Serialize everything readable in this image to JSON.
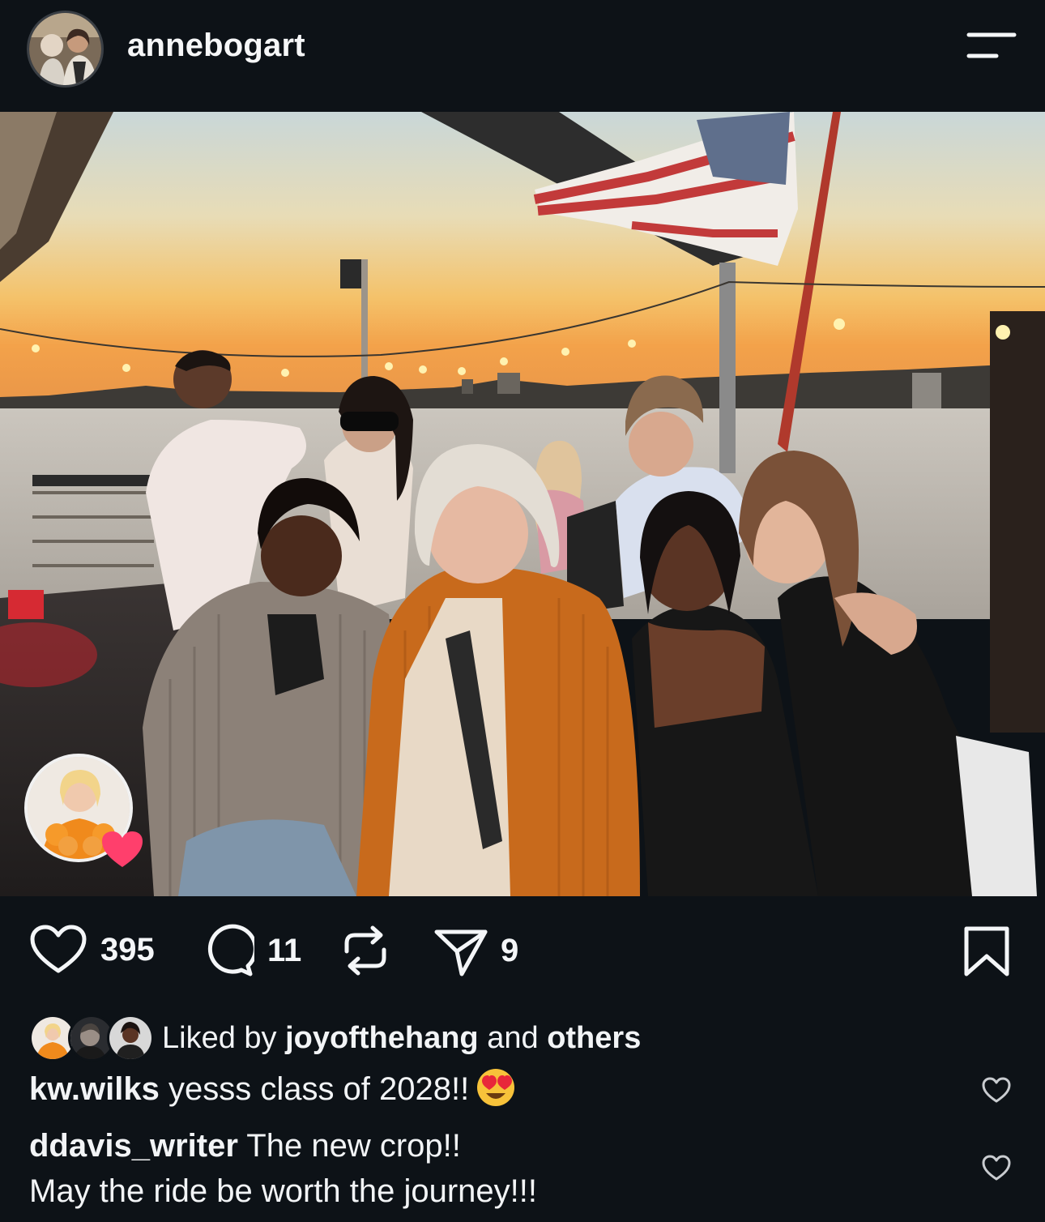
{
  "post": {
    "username": "annebogart"
  },
  "actions": {
    "likes": "395",
    "comments": "11",
    "shares": "9"
  },
  "liked_by": {
    "prefix": "Liked by",
    "user": "joyofthehang",
    "middle": "and",
    "suffix": "others"
  },
  "comments": [
    {
      "user": "kw.wilks",
      "text": "yesss class of 2028!!",
      "emoji": "heart-eyes-emoji"
    },
    {
      "user": "ddavis_writer",
      "text": "The new crop!!",
      "text2": "May the ride be worth the journey!!!"
    }
  ],
  "colors": {
    "background": "#0d1217",
    "text": "#f3f5f7",
    "story_heart": "#ff3f6c"
  },
  "icons": {
    "menu": "menu-icon",
    "like": "heart-icon",
    "comment": "comment-icon",
    "repost": "repost-icon",
    "share": "send-icon",
    "save": "bookmark-icon"
  }
}
